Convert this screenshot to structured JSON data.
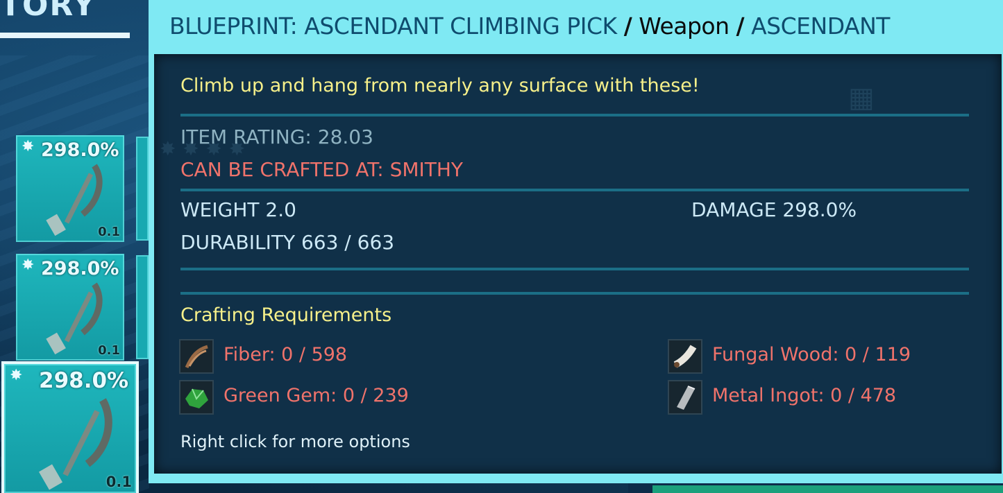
{
  "tooltip": {
    "header": {
      "prefix": "BLUEPRINT: ASCENDANT CLIMBING PICK",
      "separator": "/",
      "item_type": "Weapon",
      "quality": "ASCENDANT"
    },
    "description": "Climb up and hang from nearly any surface with these!",
    "item_rating": "ITEM RATING: 28.03",
    "crafted_at": "CAN BE CRAFTED AT: SMITHY",
    "weight": "WEIGHT 2.0",
    "damage": "DAMAGE 298.0%",
    "durability": "DURABILITY 663 / 663",
    "crafting_title": "Crafting Requirements",
    "resources": [
      {
        "label": "Fiber: 0 / 598",
        "icon": "fiber-icon"
      },
      {
        "label": "Fungal Wood: 0 / 119",
        "icon": "fungal-wood-icon"
      },
      {
        "label": "Green Gem: 0 / 239",
        "icon": "green-gem-icon"
      },
      {
        "label": "Metal Ingot: 0 / 478",
        "icon": "metal-ingot-icon"
      }
    ],
    "hint": "Right click for more options"
  },
  "inventory": {
    "title": "TORY",
    "slots": [
      {
        "damage": "298.0%",
        "weight": "0.1"
      },
      {
        "damage": "298.0%",
        "weight": "0.1"
      },
      {
        "damage": "298.0%",
        "weight": "0.1"
      }
    ]
  },
  "colors": {
    "tooltip_border": "#7fe9f3",
    "description": "#f6f08a",
    "requirement": "#f0736b",
    "stat": "#cde9f6",
    "slot": "#1fb7bd"
  }
}
